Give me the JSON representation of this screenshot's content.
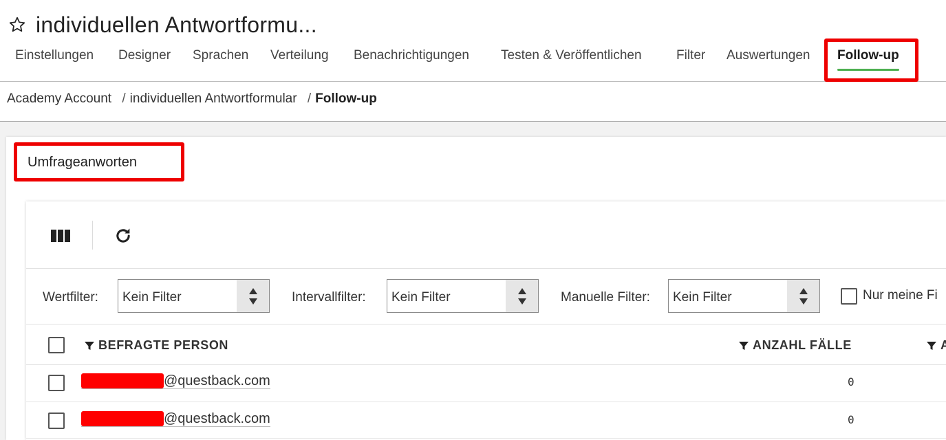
{
  "header": {
    "title": "individuellen Antwortformu..."
  },
  "tabs": [
    {
      "label": "Einstellungen"
    },
    {
      "label": "Designer"
    },
    {
      "label": "Sprachen"
    },
    {
      "label": "Verteilung"
    },
    {
      "label": "Benachrichtigungen"
    },
    {
      "label": "Testen & Veröffentlichen"
    },
    {
      "label": "Filter"
    },
    {
      "label": "Auswertungen"
    },
    {
      "label": "Follow-up",
      "active": true
    }
  ],
  "breadcrumb": {
    "items": [
      "Academy Account",
      "individuellen Antwortformular",
      "Follow-up"
    ],
    "separator": "/"
  },
  "section": {
    "title": "Umfrageanworten"
  },
  "toolbar": {
    "icons": [
      "columns-icon",
      "refresh-icon"
    ]
  },
  "filters": {
    "value_filter": {
      "label": "Wertfilter:",
      "value": "Kein Filter"
    },
    "interval_filter": {
      "label": "Intervallfilter:",
      "value": "Kein Filter"
    },
    "manual_filter": {
      "label": "Manuelle Filter:",
      "value": "Kein Filter"
    },
    "only_mine": {
      "label": "Nur meine Fi"
    }
  },
  "table": {
    "columns": [
      "BEFRAGTE PERSON",
      "ANZAHL FÄLLE",
      "A"
    ],
    "rows": [
      {
        "email_suffix": "@questback.com",
        "count": "0"
      },
      {
        "email_suffix": "@questback.com",
        "count": "0"
      }
    ]
  },
  "colors": {
    "highlight": "#ee0000",
    "active_tab_underline": "#4caf50",
    "redaction": "#ff0000"
  }
}
